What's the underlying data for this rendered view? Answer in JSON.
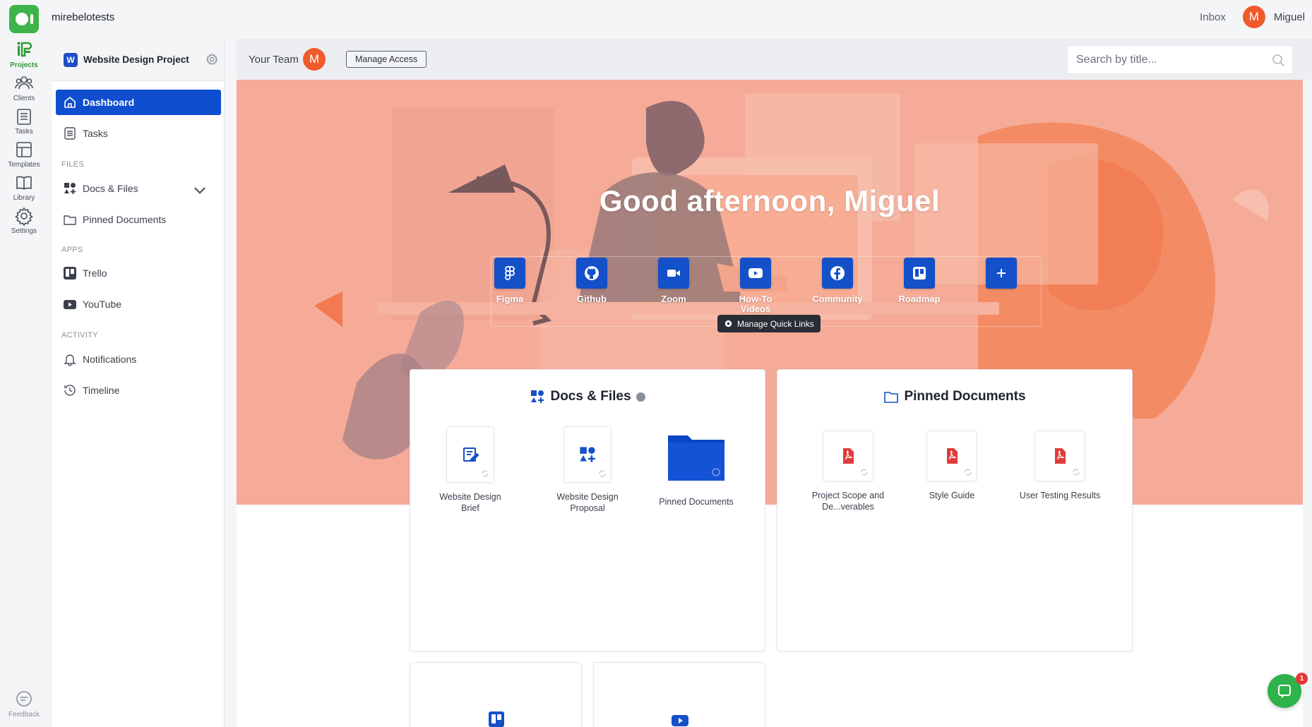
{
  "topbar": {
    "workspace": "mirebelotests",
    "inbox": "Inbox",
    "user_initial": "M",
    "user_name": "Miguel"
  },
  "rail": [
    {
      "label": "Projects",
      "icon": "projects-icon",
      "active": true
    },
    {
      "label": "Clients",
      "icon": "clients-icon"
    },
    {
      "label": "Tasks",
      "icon": "tasks-icon"
    },
    {
      "label": "Templates",
      "icon": "templates-icon"
    },
    {
      "label": "Library",
      "icon": "library-icon"
    },
    {
      "label": "Settings",
      "icon": "settings-icon"
    },
    {
      "label": "Feedback",
      "icon": "feedback-icon"
    }
  ],
  "project": {
    "badge": "W",
    "title": "Website Design Project"
  },
  "sidebar": {
    "dashboard": "Dashboard",
    "tasks": "Tasks",
    "files_section": "FILES",
    "docs_files": "Docs & Files",
    "pinned_documents": "Pinned Documents",
    "apps_section": "APPS",
    "trello": "Trello",
    "youtube": "YouTube",
    "activity_section": "ACTIVITY",
    "notifications": "Notifications",
    "timeline": "Timeline"
  },
  "header": {
    "your_team": "Your Team",
    "team_initial": "M",
    "manage_access": "Manage Access",
    "search_placeholder": "Search by title..."
  },
  "hero": {
    "greeting": "Good afternoon, Miguel",
    "quick_links": [
      {
        "label": "Figma",
        "icon": "figma-icon"
      },
      {
        "label": "Github",
        "icon": "github-icon"
      },
      {
        "label": "Zoom",
        "icon": "zoom-icon"
      },
      {
        "label": "How-To Videos",
        "icon": "youtube-icon"
      },
      {
        "label": "Community",
        "icon": "facebook-icon"
      },
      {
        "label": "Roadmap",
        "icon": "trello-icon"
      },
      {
        "label": "",
        "icon": "plus-icon"
      }
    ],
    "manage_quick_links": "Manage Quick Links"
  },
  "docs_card": {
    "title": "Docs & Files",
    "files": [
      "Website Design Brief",
      "Website Design Proposal",
      "Pinned Documents"
    ]
  },
  "pinned_card": {
    "title": "Pinned Documents",
    "files": [
      "Project Scope and De...verables",
      "Style Guide",
      "User Testing Results"
    ]
  },
  "chat": {
    "badge": "1"
  },
  "colors": {
    "brand_green": "#3db34a",
    "accent_blue": "#0f4fcf",
    "avatar_orange": "#f15a29"
  }
}
